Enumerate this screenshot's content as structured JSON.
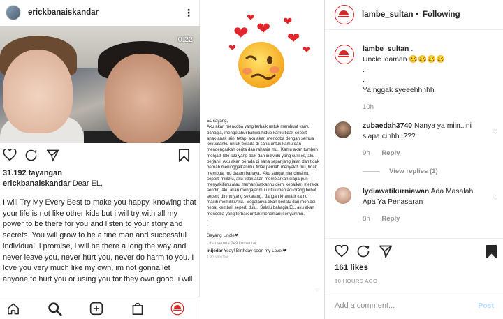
{
  "left_post": {
    "username": "erickbanaiskandar",
    "video_time": "0:22",
    "views": "31.192 tayangan",
    "caption_user": "erickbanaiskandar",
    "caption_start": "Dear EL,",
    "caption_body": "I will Try My Every Best to make you happy, knowing that your life is not like other kids but i will try with all my power to be there for you and listen to your story and secrets. You will grow to be a fine man and successful individual, i promise, i will be there a long the way and never leave you, never hurt you, never do harm to you. I love you very much like my own, im not gonna let anyone to hurt you or using you for they own good. i will teach you to be a great person that"
  },
  "letter": {
    "body": "EL sayang,\nAku akan mencoba yang terbaik untuk membuat kamu bahagia, mengetahui bahwa hidup kamu tidak seperti anak-anak lain, tetapi aku akan mencoba dengan semua kekuatanku untuk berada di sana untuk kamu dan mendengarkan cerita dan rahasia mu.  Kamu akan tumbuh menjadi laki-laki yang baik dan individu yang sukses, aku berjanji, Aku akan berada di sana sepanjang jalan dan tidak pernah meninggalkanmu, tidak pernah menyakiti mu, tidak membuat mu dalam bahaya.  Aku sangat mencintaimu seperti milikku, aku tidak akan membiarkan siapa pun menyakitimu atau memanfaatkannu demi kebaikan mereka sendiri, aku akan mengajarimu untuk menjadi orang hebat seperti dirimu yang sekarang.  Jangan khawatir kamu masih memiliki Aku.  Segalanya akan berlalu dan menjadi hebat kembali seperti dulu.  Selalu bahagia EL, aku akan mencoba yang terbaik untuk menemani senyummu.\n.\n.",
    "sign": "Sayang Uncle❤",
    "comments_link": "Lihat semua 249 komentar",
    "comment_user": "inijedar",
    "comment_text": "Yeay! Birthday soon my Love!❤",
    "comment_time": "1 jam yang lalu"
  },
  "right_post": {
    "account": "lambe_sultan",
    "follow_label": "Following",
    "separator": "•",
    "caption_user": "lambe_sultan",
    "caption_user_suffix": ".",
    "caption_line1": "Uncle idaman 🥴🥴🥴🥴",
    "caption_dot1": ".",
    "caption_dot2": ".",
    "caption_line2": "Ya nggak syeeehhhhh",
    "caption_time": "10h",
    "comments": [
      {
        "user": "zubaedah3740",
        "text": "Nanya ya miin..ini siapa cihhh..???",
        "time": "9h",
        "reply": "Reply",
        "replies": "View replies (1)"
      },
      {
        "user": "lydiawatikurniawan",
        "text": "Ada Masalah Apa Ya Penasaran",
        "time": "8h",
        "reply": "Reply"
      }
    ],
    "likes": "161 likes",
    "time_ago": "10 HOURS AGO",
    "comment_placeholder": "Add a comment...",
    "post_label": "Post"
  },
  "colors": {
    "heart": "#e0262a",
    "brand_red": "#d32a2a",
    "post_blue": "#b3dbff"
  }
}
